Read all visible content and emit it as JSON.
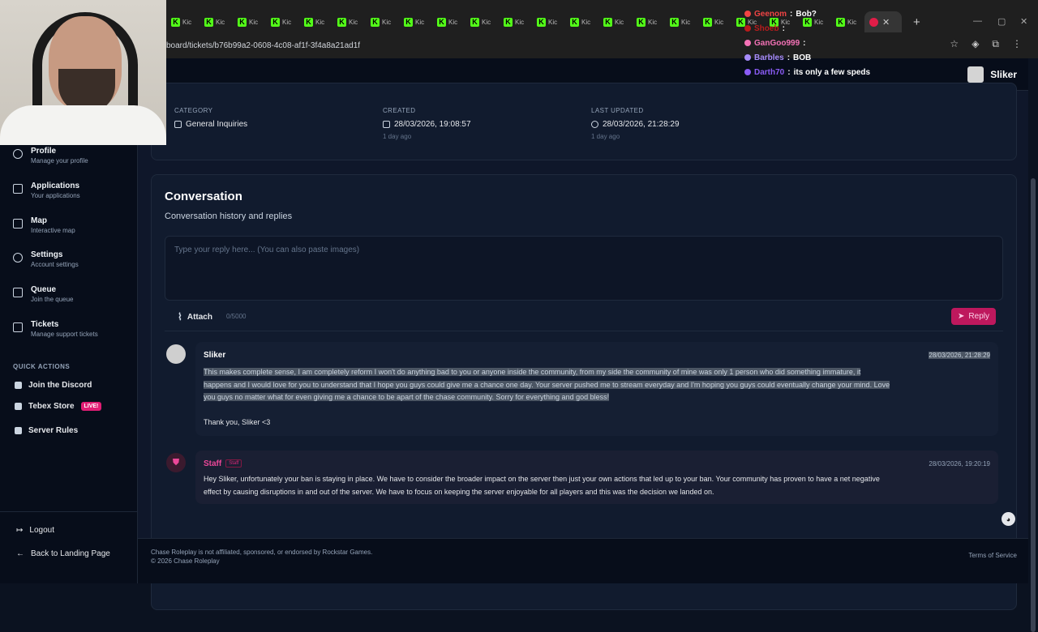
{
  "browser": {
    "url": "board/tickets/b76b99a2-0608-4c08-af1f-3f4a8a21ad1f",
    "tab_label": "Kic",
    "tab_count": 21
  },
  "stream_chat": [
    {
      "user": "Geenom",
      "message": "Bob?",
      "color": "#ef4444"
    },
    {
      "user": "Shoeb",
      "message": "",
      "color": "#b91c1c"
    },
    {
      "user": "GanGoo999",
      "message": "",
      "color": "#f472b6"
    },
    {
      "user": "Barbles",
      "message": "BOB",
      "color": "#a78bfa"
    },
    {
      "user": "Darth70",
      "message": "its only a few speds",
      "color": "#8b5cf6"
    }
  ],
  "header": {
    "user_name": "Sliker"
  },
  "sidebar": {
    "items": [
      {
        "label": "Profile",
        "sub": "Manage your profile"
      },
      {
        "label": "Applications",
        "sub": "Your applications"
      },
      {
        "label": "Map",
        "sub": "Interactive map"
      },
      {
        "label": "Settings",
        "sub": "Account settings"
      },
      {
        "label": "Queue",
        "sub": "Join the queue"
      },
      {
        "label": "Tickets",
        "sub": "Manage support tickets"
      }
    ],
    "quick_actions_title": "QUICK ACTIONS",
    "quick_actions": [
      {
        "label": "Join the Discord"
      },
      {
        "label": "Tebex Store",
        "badge": "LIVE!"
      },
      {
        "label": "Server Rules"
      }
    ],
    "logout": "Logout",
    "back": "Back to Landing Page"
  },
  "ticket_meta": {
    "category_label": "CATEGORY",
    "category_value": "General Inquiries",
    "created_label": "CREATED",
    "created_value": "28/03/2026, 19:08:57",
    "created_ago": "1 day ago",
    "updated_label": "LAST UPDATED",
    "updated_value": "28/03/2026, 21:28:29",
    "updated_ago": "1 day ago"
  },
  "conversation": {
    "title": "Conversation",
    "subtitle": "Conversation history and replies",
    "placeholder": "Type your reply here... (You can also paste images)",
    "attach": "Attach",
    "char_count": "0/5000",
    "reply": "Reply"
  },
  "messages": [
    {
      "author": "Sliker",
      "time": "28/03/2026, 21:28:29",
      "body_lines": [
        "This makes complete sense, I am completely reform I won't do anything bad to you or anyone inside the community, from my side the community of mine was only 1 person who did something immature, it",
        "happens and I would love for you to understand that I hope you guys could give me a chance one day. Your server pushed me to stream everyday and I'm hoping you guys could eventually change your mind. Love",
        "you guys no matter what for even giving me a chance to be apart of the chase community. Sorry for everything and god bless!"
      ],
      "signoff": "Thank you, Sliker <3"
    },
    {
      "author": "Staff",
      "tag": "Staff",
      "time": "28/03/2026, 19:20:19",
      "body_lines": [
        "Hey Sliker, unfortunately your ban is staying in place. We have to consider the broader impact on the server then just your own actions that led up to your ban. Your community has proven to have a net negative",
        "effect by causing disruptions in and out of the server. We have to focus on keeping the server enjoyable for all players and this was the decision we landed on."
      ]
    }
  ],
  "footer": {
    "disclaimer": "Chase Roleplay is not affiliated, sponsored, or endorsed by Rockstar Games.",
    "copyright": "© 2026 Chase Roleplay",
    "terms": "Terms of Service"
  },
  "colors": {
    "accent": "#be185d",
    "kick_green": "#53fc18",
    "bg": "#0f172a"
  }
}
